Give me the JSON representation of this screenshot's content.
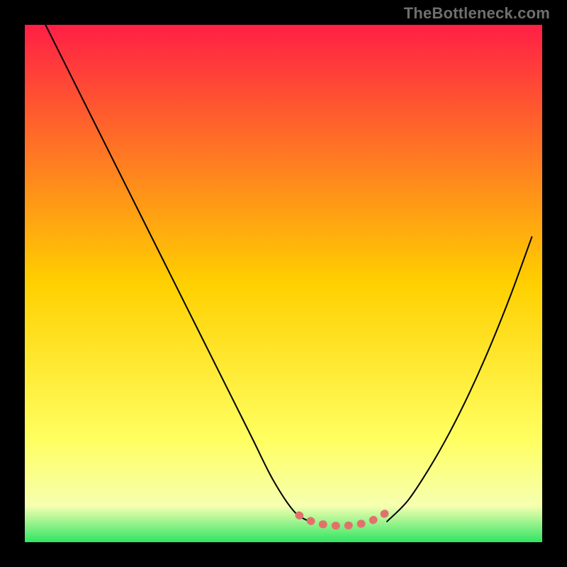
{
  "watermark": "TheBottleneck.com",
  "chart_data": {
    "type": "line",
    "title": "",
    "xlabel": "",
    "ylabel": "",
    "xlim": [
      0,
      100
    ],
    "ylim": [
      0,
      100
    ],
    "grid": false,
    "legend": false,
    "background_gradient": {
      "stops": [
        {
          "offset": 0.0,
          "color": "#ff1f46"
        },
        {
          "offset": 0.5,
          "color": "#ffd000"
        },
        {
          "offset": 0.8,
          "color": "#ffff60"
        },
        {
          "offset": 0.93,
          "color": "#f6ffb0"
        },
        {
          "offset": 1.0,
          "color": "#2fe564"
        }
      ]
    },
    "series": [
      {
        "name": "left-curve",
        "stroke": "#000000",
        "x": [
          4,
          8,
          12,
          16,
          20,
          24,
          28,
          32,
          36,
          40,
          44,
          48,
          52,
          55
        ],
        "y": [
          100,
          92,
          84,
          76,
          68,
          60,
          52,
          44,
          36,
          28,
          20,
          12,
          6,
          4
        ]
      },
      {
        "name": "right-curve",
        "stroke": "#000000",
        "x": [
          70,
          74,
          78,
          82,
          86,
          90,
          94,
          98
        ],
        "y": [
          4,
          8,
          14,
          21,
          29,
          38,
          48,
          59
        ]
      },
      {
        "name": "optimal-band",
        "stroke": "#e1726b",
        "x": [
          53,
          56,
          58,
          60,
          62,
          64,
          66,
          68,
          70
        ],
        "y": [
          5.2,
          3.8,
          3.4,
          3.2,
          3.2,
          3.4,
          3.8,
          4.6,
          5.8
        ]
      }
    ]
  }
}
